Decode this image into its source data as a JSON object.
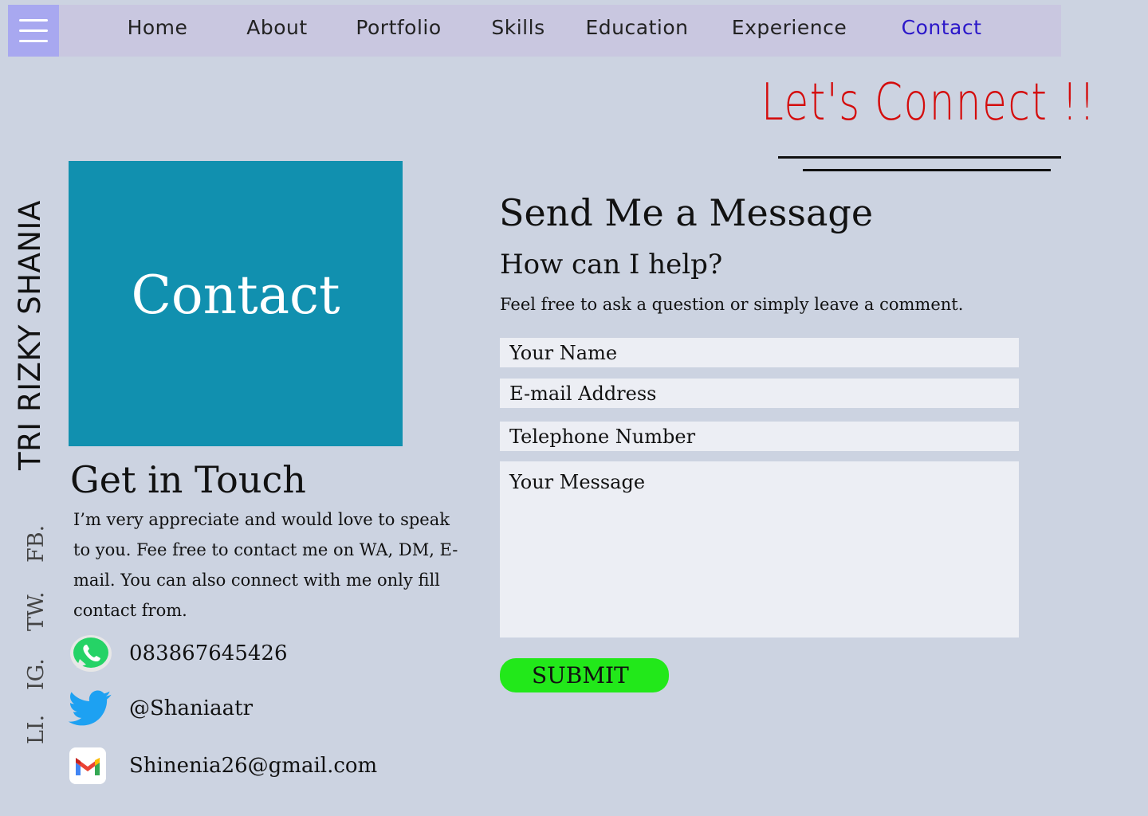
{
  "nav": {
    "items": [
      {
        "label": "Home"
      },
      {
        "label": "About"
      },
      {
        "label": "Portfolio"
      },
      {
        "label": "Skills"
      },
      {
        "label": "Education"
      },
      {
        "label": "Experience"
      },
      {
        "label": "Contact",
        "active": true
      }
    ]
  },
  "hero": {
    "lets_connect": "Let's Connect !!",
    "vertical_name": "TRI RIZKY SHANIA",
    "social": [
      "FB.",
      "TW.",
      "IG.",
      "LI."
    ]
  },
  "contact_box": {
    "title": "Contact"
  },
  "get_in_touch": {
    "heading": "Get in Touch",
    "body": "I’m very appreciate and would love to speak to you. Fee free to contact me on WA, DM, E-mail. You can also connect with me only fill contact from.",
    "phone": "083867645426",
    "twitter": "@Shaniaatr",
    "email": "Shinenia26@gmail.com"
  },
  "form": {
    "heading": "Send Me a Message",
    "subheading": "How can I help?",
    "intro": "Feel free to ask a question or simply leave a comment.",
    "name_placeholder": "Your Name",
    "email_placeholder": "E-mail Address",
    "phone_placeholder": "Telephone Number",
    "message_placeholder": "Your Message",
    "submit_label": "SUBMIT"
  },
  "colors": {
    "background": "#ccd3e1",
    "nav": "#c9c7e0",
    "hamburger": "#a8a8f0",
    "active_nav": "#2b17c9",
    "accent_red": "#d40d0d",
    "contact_box": "#1190af",
    "submit": "#22e81a"
  },
  "icons": [
    "menu-icon",
    "whatsapp-icon",
    "twitter-icon",
    "gmail-icon"
  ]
}
